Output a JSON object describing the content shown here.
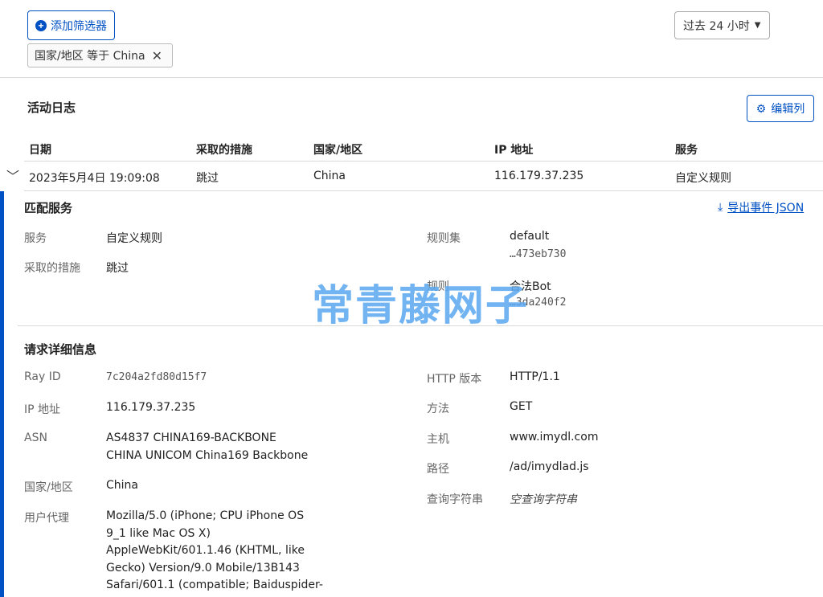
{
  "filters": {
    "add_label": "添加筛选器",
    "active_filter": "国家/地区 等于 China",
    "time_range": "过去 24 小时"
  },
  "activity": {
    "title": "活动日志",
    "edit_columns": "编辑列",
    "columns": [
      "日期",
      "采取的措施",
      "国家/地区",
      "IP 地址",
      "服务"
    ],
    "row": {
      "date": "2023年5月4日 19:09:08",
      "action": "跳过",
      "country": "China",
      "ip": "116.179.37.235",
      "service": "自定义规则"
    }
  },
  "matched": {
    "title": "匹配服务",
    "export": "导出事件 JSON",
    "service_label": "服务",
    "service_value": "自定义规则",
    "action_label": "采取的措施",
    "action_value": "跳过",
    "ruleset_label": "规则集",
    "ruleset_value": "default",
    "ruleset_id": "…473eb730",
    "rule_label": "规则",
    "rule_value": "合法Bot",
    "rule_id": "…3da240f2"
  },
  "watermark": "常青藤网子",
  "request": {
    "title": "请求详细信息",
    "ray_label": "Ray ID",
    "ray_value": "7c204a2fd80d15f7",
    "ip_label": "IP 地址",
    "ip_value": "116.179.37.235",
    "asn_label": "ASN",
    "asn_line1": "AS4837 CHINA169-BACKBONE",
    "asn_line2": "CHINA UNICOM China169 Backbone",
    "country_label": "国家/地区",
    "country_value": "China",
    "ua_label": "用户代理",
    "ua_value": "Mozilla/5.0 (iPhone; CPU iPhone OS 9_1 like Mac OS X) AppleWebKit/601.1.46 (KHTML, like Gecko) Version/9.0 Mobile/13B143 Safari/601.1 (compatible; Baiduspider-",
    "http_label": "HTTP 版本",
    "http_value": "HTTP/1.1",
    "method_label": "方法",
    "method_value": "GET",
    "host_label": "主机",
    "host_value": "www.imydl.com",
    "path_label": "路径",
    "path_value": "/ad/imydlad.js",
    "query_label": "查询字符串",
    "query_value": "空查询字符串"
  },
  "colors": {
    "accent": "#0051c3",
    "watermark": "#5aa8f0"
  }
}
